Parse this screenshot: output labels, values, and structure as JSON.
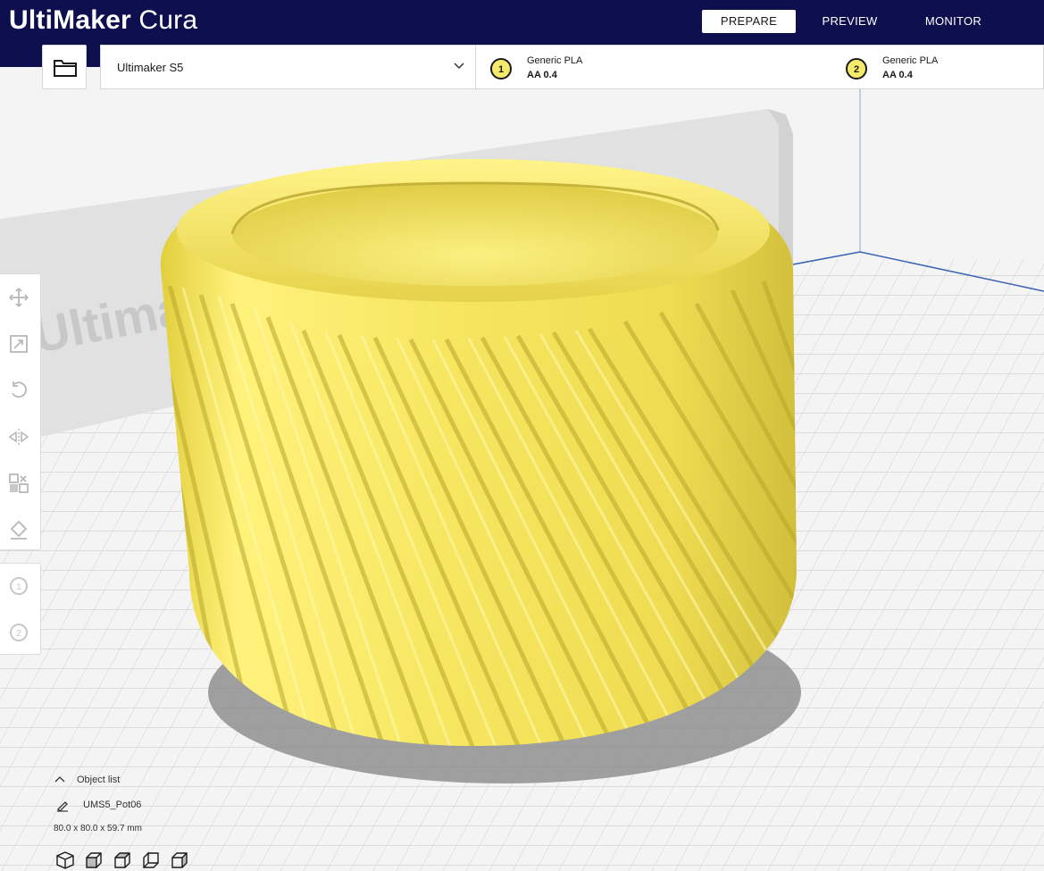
{
  "app": {
    "brand": "UltiMaker",
    "product": "Cura"
  },
  "stages": [
    {
      "label": "PREPARE",
      "active": true
    },
    {
      "label": "PREVIEW",
      "active": false
    },
    {
      "label": "MONITOR",
      "active": false
    }
  ],
  "printer": {
    "name": "Ultimaker S5"
  },
  "extruders": [
    {
      "number": "1",
      "material": "Generic PLA",
      "nozzle": "AA 0.4"
    },
    {
      "number": "2",
      "material": "Generic PLA",
      "nozzle": "AA 0.4"
    }
  ],
  "buildplate": {
    "logo_text": "Ultimaker"
  },
  "tools": [
    "move-icon",
    "scale-icon",
    "rotate-icon",
    "mirror-icon",
    "per-model-settings-icon",
    "support-blocker-icon"
  ],
  "extruder_tools": [
    "1",
    "2"
  ],
  "object_list": {
    "title": "Object list",
    "object_name": "UMS5_Pot06",
    "dimensions": "80.0 x 80.0 x 59.7 mm"
  },
  "view_buttons": [
    "3d-view-icon",
    "front-view-icon",
    "top-view-icon",
    "left-view-icon",
    "right-view-icon"
  ],
  "colors": {
    "header": "#0d0f4e",
    "model_yellow": "#f6ea6a",
    "model_shadow": "#c9b838",
    "grid_line": "#c8c8c8",
    "accent_blue": "#3b64b5"
  }
}
